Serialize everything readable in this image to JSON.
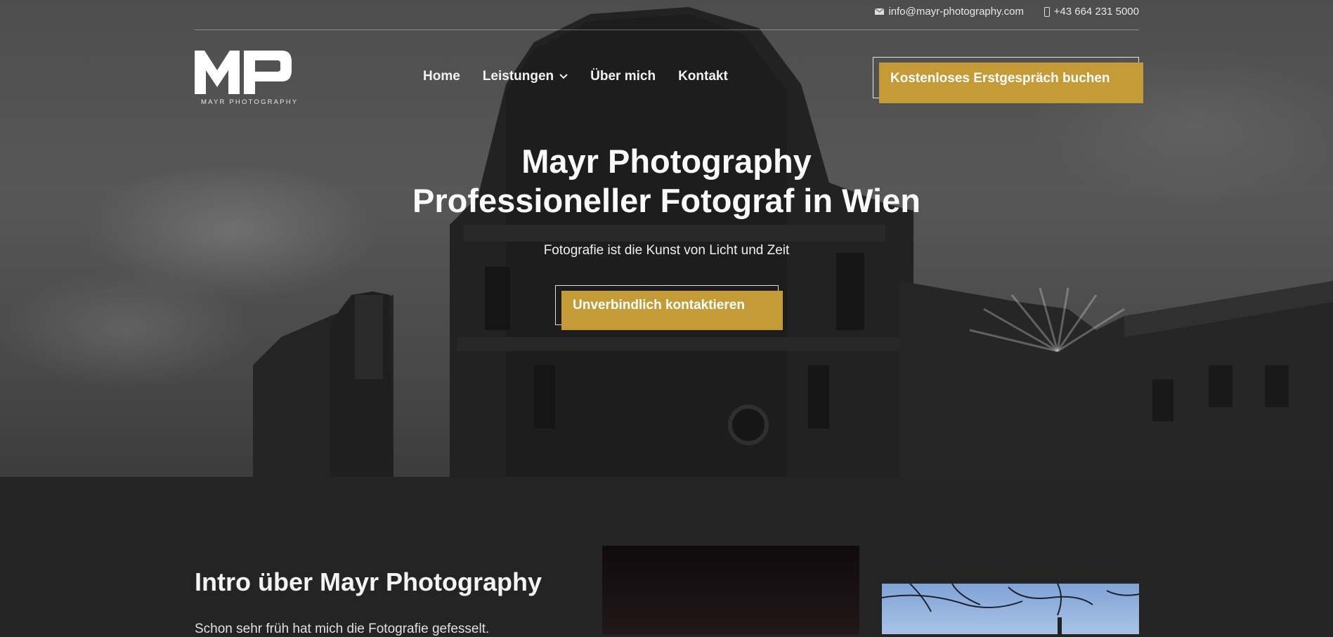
{
  "topbar": {
    "email": "info@mayr-photography.com",
    "phone": "+43 664 231 5000",
    "email_icon": "mail-icon",
    "phone_icon": "phone-icon"
  },
  "logo": {
    "letters": "MP",
    "text": "MAYR PHOTOGRAPHY"
  },
  "nav": {
    "items": [
      {
        "label": "Home"
      },
      {
        "label": "Leistungen",
        "icon": "chevron-down-icon"
      },
      {
        "label": "Über mich"
      },
      {
        "label": "Kontakt"
      }
    ],
    "cta_label": "Kostenloses Erstgespräch buchen"
  },
  "hero": {
    "title_line1": "Mayr Photography",
    "title_line2": "Professioneller Fotograf in Wien",
    "subtitle": "Fotografie ist die Kunst von Licht und Zeit",
    "cta_label": "Unverbindlich kontaktieren"
  },
  "intro": {
    "title": "Intro über Mayr Photography",
    "text": "Schon sehr früh hat mich die Fotografie gefesselt."
  },
  "colors": {
    "accent": "#c49b37",
    "section_bg": "#242424"
  }
}
